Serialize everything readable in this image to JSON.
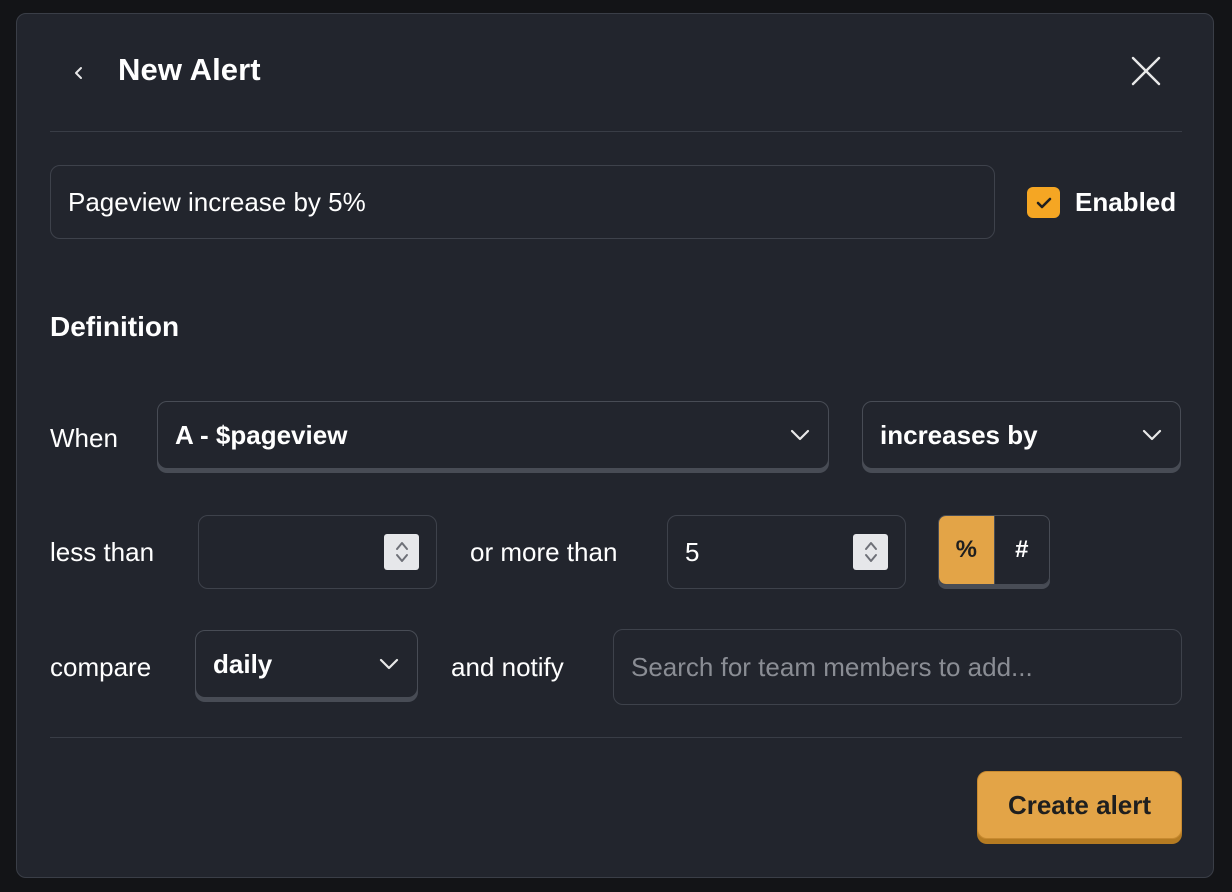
{
  "header": {
    "title": "New Alert",
    "back_icon": "chevron-left-icon",
    "close_icon": "close-icon"
  },
  "name_field": {
    "value": "Pageview increase by 5%"
  },
  "enabled": {
    "label": "Enabled",
    "checked": true,
    "color": "#f5a623"
  },
  "definition": {
    "title": "Definition",
    "when_label": "When",
    "series_select": "A - $pageview",
    "condition_select": "increases by",
    "less_than_label": "less than",
    "less_than_value": "",
    "more_than_label": "or more than",
    "more_than_value": "5",
    "unit_toggle": {
      "options": [
        "%",
        "#"
      ],
      "selected": "%"
    },
    "compare_label": "compare",
    "compare_select": "daily",
    "notify_label": "and notify",
    "notify_placeholder": "Search for team members to add..."
  },
  "footer": {
    "create_label": "Create alert"
  },
  "colors": {
    "accent": "#e3a447",
    "background": "#22252d"
  }
}
